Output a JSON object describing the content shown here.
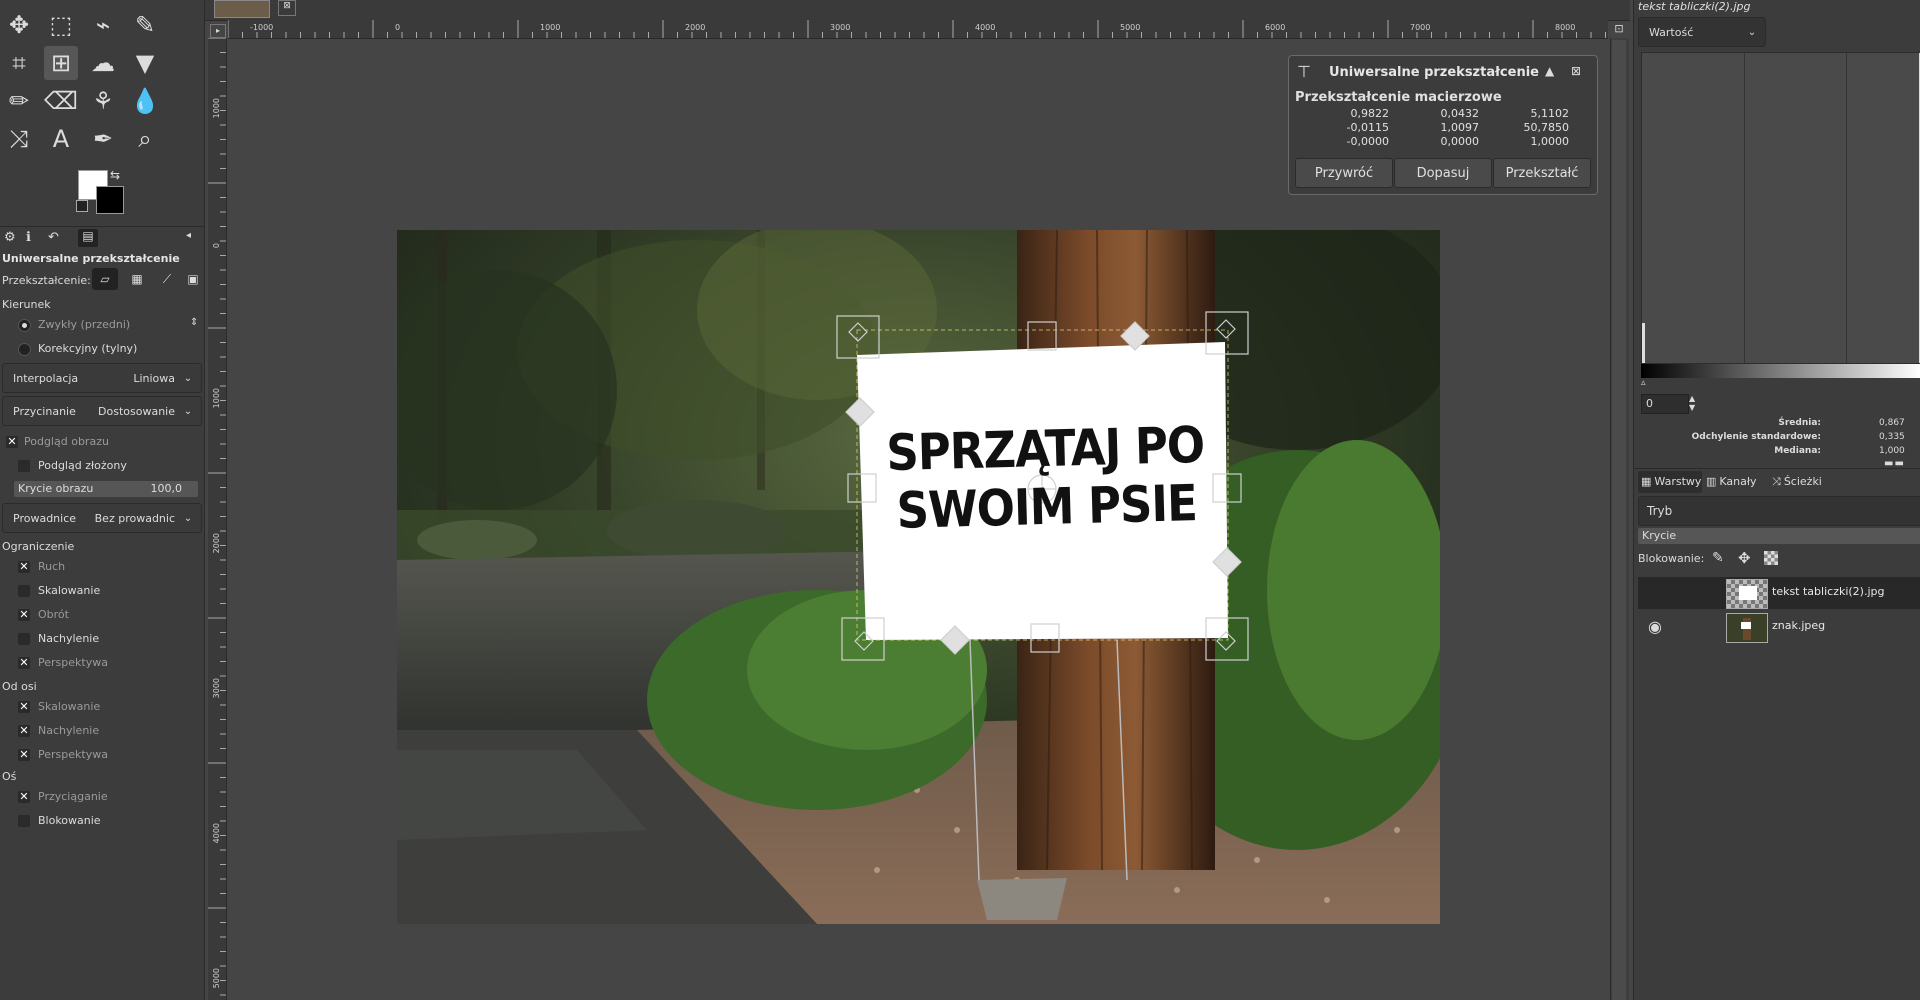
{
  "toolbox": {
    "tools": [
      {
        "name": "move-tool-icon",
        "glyph": "✥"
      },
      {
        "name": "rect-select-tool-icon",
        "glyph": "⬚"
      },
      {
        "name": "lasso-tool-icon",
        "glyph": "⌁"
      },
      {
        "name": "fuzzy-select-tool-icon",
        "glyph": "✎"
      },
      {
        "name": "crop-tool-icon",
        "glyph": "⌗"
      },
      {
        "name": "unified-transform-tool-icon",
        "glyph": "⊞"
      },
      {
        "name": "warp-tool-icon",
        "glyph": "☁"
      },
      {
        "name": "bucket-fill-tool-icon",
        "glyph": "▼"
      },
      {
        "name": "paintbrush-tool-icon",
        "glyph": "✏"
      },
      {
        "name": "eraser-tool-icon",
        "glyph": "⌫"
      },
      {
        "name": "clone-tool-icon",
        "glyph": "⚘"
      },
      {
        "name": "smudge-tool-icon",
        "glyph": "💧"
      },
      {
        "name": "paths-tool-icon",
        "glyph": "⤨"
      },
      {
        "name": "text-tool-icon",
        "glyph": "A"
      },
      {
        "name": "color-picker-tool-icon",
        "glyph": "✒"
      },
      {
        "name": "zoom-tool-icon",
        "glyph": "⌕"
      }
    ],
    "options": {
      "title": "Uniwersalne przekształcenie",
      "transform_label": "Przekształcenie:",
      "direction_label": "Kierunek",
      "direction_normal": "Zwykły (przedni)",
      "direction_corrective": "Korekcyjny (tylny)",
      "interpolation_label": "Interpolacja",
      "interpolation_value": "Liniowa",
      "clipping_label": "Przycinanie",
      "clipping_value": "Dostosowanie",
      "show_preview": "Podgląd obrazu",
      "composited_preview": "Podgląd złożony",
      "image_opacity_label": "Krycie obrazu",
      "image_opacity_value": "100,0",
      "guides_label": "Prowadnice",
      "guides_value": "Bez prowadnic",
      "constrain_label": "Ograniczenie",
      "c_move": "Ruch",
      "c_scale": "Skalowanie",
      "c_rotate": "Obrót",
      "c_shear": "Nachylenie",
      "c_perspective": "Perspektywa",
      "from_pivot_label": "Od osi",
      "p_scale": "Skalowanie",
      "p_shear": "Nachylenie",
      "p_perspective": "Perspektywa",
      "pivot_label": "Oś",
      "snap": "Przyciąganie",
      "lock": "Blokowanie"
    }
  },
  "rulers": {
    "h": [
      "-1000",
      "0",
      "1000",
      "2000",
      "3000",
      "4000",
      "5000",
      "6000",
      "7000",
      "8000"
    ],
    "v": [
      "1000",
      "0",
      "1000",
      "2000",
      "3000",
      "4000",
      "5000"
    ]
  },
  "canvas": {
    "sign_line1": "SPRZĄTAJ PO",
    "sign_line2": "SWOIM PSIE"
  },
  "transform_dialog": {
    "title": "Uniwersalne przekształcenie",
    "matrix_label": "Przekształcenie macierzowe",
    "matrix": [
      [
        "0,9822",
        "0,0432",
        "5,1102"
      ],
      [
        "-0,0115",
        "1,0097",
        "50,7850"
      ],
      [
        "-0,0000",
        "0,0000",
        "1,0000"
      ]
    ],
    "reset": "Przywróć",
    "readjust": "Dopasuj",
    "transform": "Przekształć"
  },
  "histogram": {
    "image_name": "tekst tabliczki(2).jpg",
    "channel": "Wartość",
    "range_start": "0",
    "mean_label": "Średnia:",
    "mean_value": "0,867",
    "std_label": "Odchylenie standardowe:",
    "std_value": "0,335",
    "median_label": "Mediana:",
    "median_value": "1,000"
  },
  "layers_panel": {
    "tabs": [
      "Warstwy",
      "Kanały",
      "Ścieżki"
    ],
    "mode_label": "Tryb",
    "opacity_label": "Krycie",
    "lock_label": "Blokowanie:",
    "layers": [
      {
        "name": "tekst tabliczki(2).jpg",
        "visible": false,
        "selected": true
      },
      {
        "name": "znak.jpeg",
        "visible": true,
        "selected": false
      }
    ]
  }
}
